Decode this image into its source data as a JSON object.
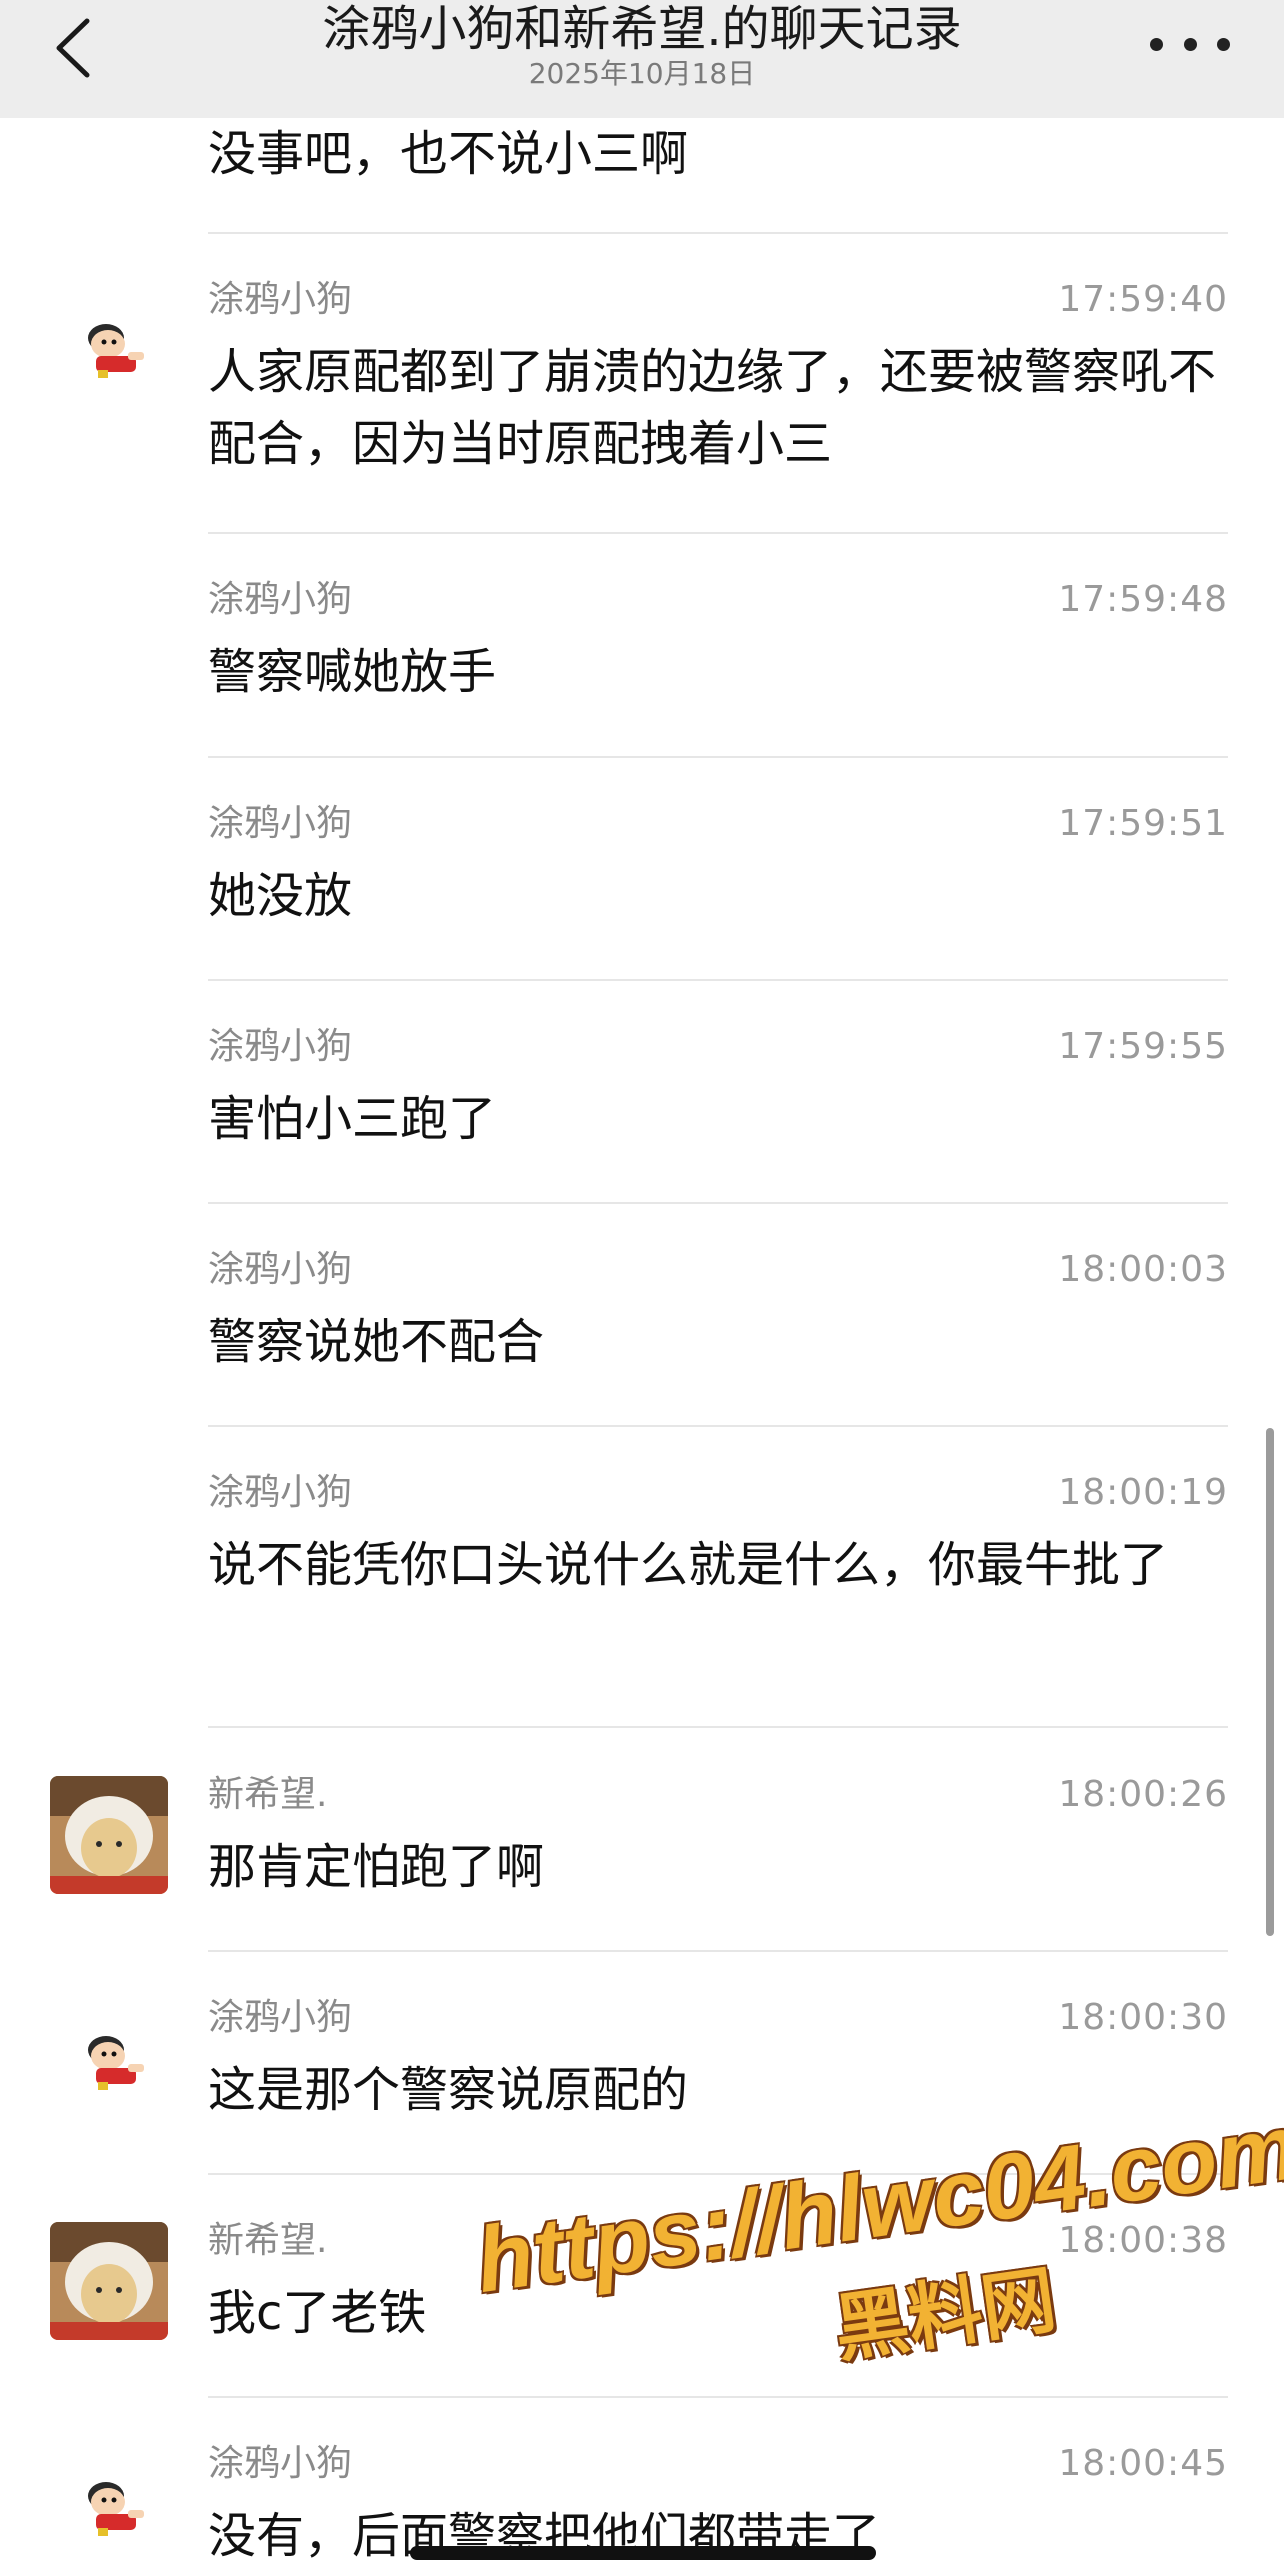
{
  "header": {
    "title": "涂鸦小狗和新希望.的聊天记录",
    "subtitle": "2025年10月18日",
    "back_icon": "chevron-left-icon",
    "more_icon": "more-horizontal-icon"
  },
  "messages": [
    {
      "sender": "",
      "time": "",
      "text": "没事吧，也不说小三啊",
      "avatar": "none"
    },
    {
      "sender": "涂鸦小狗",
      "time": "17:59:40",
      "text": "人家原配都到了崩溃的边缘了，还要被警察吼不配合，因为当时原配拽着小三",
      "avatar": "cartoon-boy"
    },
    {
      "sender": "涂鸦小狗",
      "time": "17:59:48",
      "text": "警察喊她放手",
      "avatar": "none"
    },
    {
      "sender": "涂鸦小狗",
      "time": "17:59:51",
      "text": "她没放",
      "avatar": "none"
    },
    {
      "sender": "涂鸦小狗",
      "time": "17:59:55",
      "text": "害怕小三跑了",
      "avatar": "none"
    },
    {
      "sender": "涂鸦小狗",
      "time": "18:00:03",
      "text": "警察说她不配合",
      "avatar": "none"
    },
    {
      "sender": "涂鸦小狗",
      "time": "18:00:19",
      "text": "说不能凭你口头说什么就是什么，你最牛批了",
      "avatar": "none"
    },
    {
      "sender": "新希望.",
      "time": "18:00:26",
      "text": "那肯定怕跑了啊",
      "avatar": "figurine"
    },
    {
      "sender": "涂鸦小狗",
      "time": "18:00:30",
      "text": "这是那个警察说原配的",
      "avatar": "cartoon-boy"
    },
    {
      "sender": "新希望.",
      "time": "18:00:38",
      "text": "我c了老铁",
      "avatar": "figurine"
    },
    {
      "sender": "涂鸦小狗",
      "time": "18:00:45",
      "text": "没有，后面警察把他们都带走了",
      "avatar": "cartoon-boy"
    }
  ],
  "watermark": {
    "url": "https://hlwc04.com",
    "name": "黑料网"
  },
  "colors": {
    "header_bg": "#ededed",
    "divider": "#e6e6e6",
    "meta_text": "#8a8a8a",
    "watermark": "#f2b233"
  }
}
